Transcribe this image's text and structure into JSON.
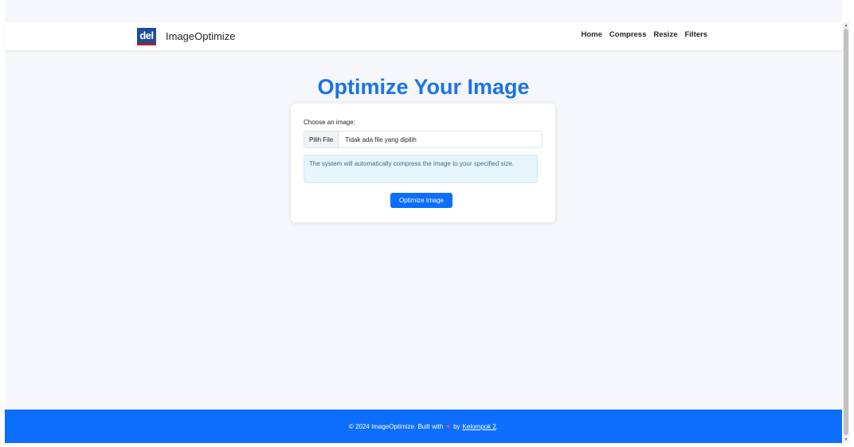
{
  "navbar": {
    "logo_text": "del",
    "brand": "ImageOptimize",
    "links": [
      "Home",
      "Compress",
      "Resize",
      "Filters"
    ]
  },
  "main": {
    "title": "Optimize Your Image",
    "choose_label": "Choose an image:",
    "file_button": "Pilih File",
    "file_status": "Tidak ada file yang dipilih",
    "info_text": "The system will automatically compress the image to your specified size.",
    "submit_label": "Optimize Image"
  },
  "footer": {
    "text_before": "© 2024 ImageOptimize. Built with",
    "heart": "♥",
    "text_by": "by",
    "link_text": "Kelompok 2",
    "text_after": "."
  },
  "colors": {
    "primary": "#0d6efd",
    "title": "#1a73e8",
    "background": "#f5f7fa",
    "info_bg": "#e7f6fc"
  },
  "icons": {
    "heart": "heart-icon",
    "logo": "del-logo-icon"
  }
}
